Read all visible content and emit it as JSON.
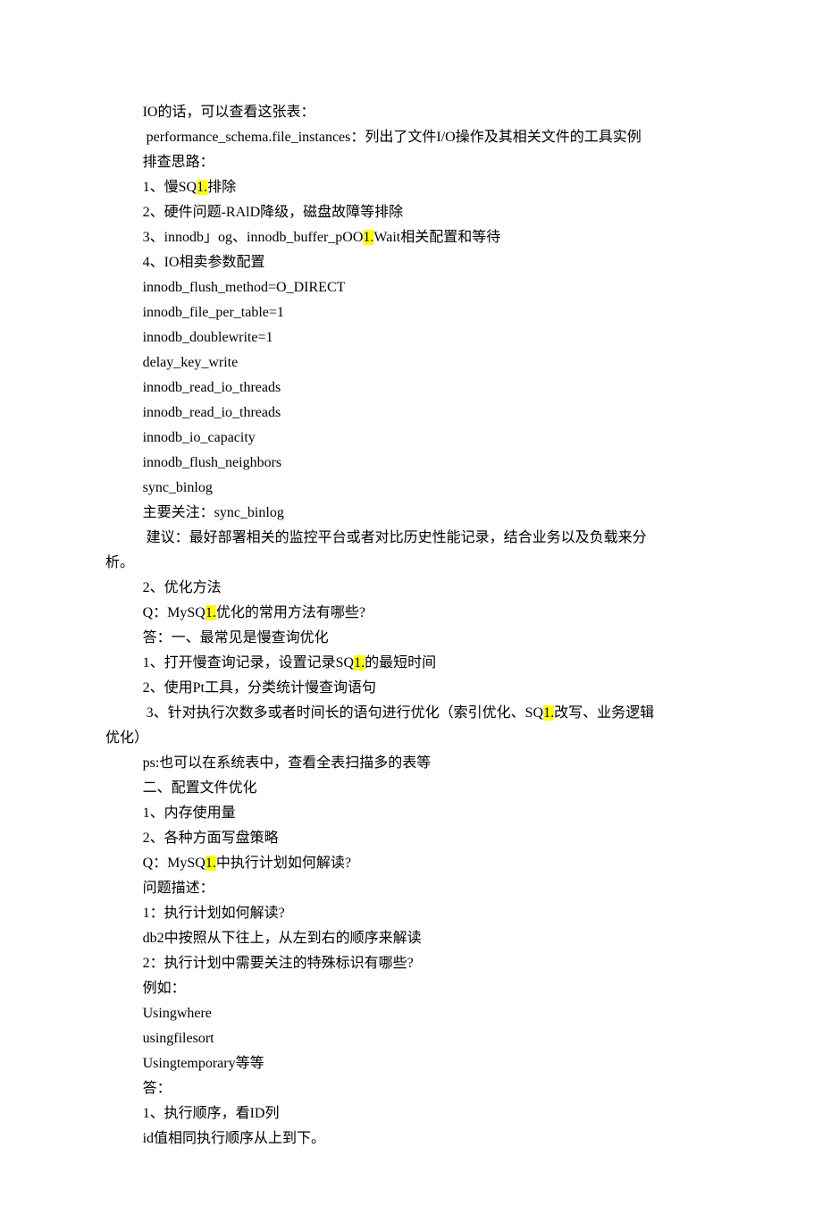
{
  "lines": [
    {
      "indent": true,
      "segments": [
        {
          "t": "IO的话，可以查看这张表："
        }
      ]
    },
    {
      "indent": true,
      "segments": [
        {
          "t": " performance_schema.file_instances：列出了文件I/O操作及其相关文件的工具实例"
        }
      ]
    },
    {
      "indent": true,
      "segments": [
        {
          "t": "排查思路："
        }
      ]
    },
    {
      "indent": true,
      "segments": [
        {
          "t": "1、慢SQ"
        },
        {
          "t": "1.",
          "hl": true
        },
        {
          "t": "排除"
        }
      ]
    },
    {
      "indent": true,
      "segments": [
        {
          "t": "2、硬件问题-RAlD降级，磁盘故障等排除"
        }
      ]
    },
    {
      "indent": true,
      "segments": [
        {
          "t": "3、innodb」og、innodb_buffer_pOO"
        },
        {
          "t": "1.",
          "hl": true
        },
        {
          "t": "Wait相关配置和等待"
        }
      ]
    },
    {
      "indent": true,
      "segments": [
        {
          "t": "4、IO相卖参数配置"
        }
      ]
    },
    {
      "indent": true,
      "segments": [
        {
          "t": "innodb_flush_method=O_DIRECT"
        }
      ]
    },
    {
      "indent": true,
      "segments": [
        {
          "t": "innodb_file_per_table=1"
        }
      ]
    },
    {
      "indent": true,
      "segments": [
        {
          "t": "innodb_doublewrite=1"
        }
      ]
    },
    {
      "indent": true,
      "segments": [
        {
          "t": "delay_key_write"
        }
      ]
    },
    {
      "indent": true,
      "segments": [
        {
          "t": "innodb_read_io_threads"
        }
      ]
    },
    {
      "indent": true,
      "segments": [
        {
          "t": "innodb_read_io_threads"
        }
      ]
    },
    {
      "indent": true,
      "segments": [
        {
          "t": "innodb_io_capacity"
        }
      ]
    },
    {
      "indent": true,
      "segments": [
        {
          "t": "innodb_flush_neighbors"
        }
      ]
    },
    {
      "indent": true,
      "segments": [
        {
          "t": "sync_binlog"
        }
      ]
    },
    {
      "indent": true,
      "segments": [
        {
          "t": "主要关注：sync_binlog"
        }
      ]
    },
    {
      "indent": true,
      "segments": [
        {
          "t": " 建议：最好部署相关的监控平台或者对比历史性能记录，结合业务以及负载来分"
        }
      ]
    },
    {
      "indent": false,
      "segments": [
        {
          "t": "析。"
        }
      ]
    },
    {
      "indent": true,
      "segments": [
        {
          "t": "2、优化方法"
        }
      ]
    },
    {
      "indent": true,
      "segments": [
        {
          "t": "Q：MySQ"
        },
        {
          "t": "1.",
          "hl": true
        },
        {
          "t": "优化的常用方法有哪些?"
        }
      ]
    },
    {
      "indent": true,
      "segments": [
        {
          "t": "答：一、最常见是慢查询优化"
        }
      ]
    },
    {
      "indent": true,
      "segments": [
        {
          "t": "1、打开慢查询记录，设置记录SQ"
        },
        {
          "t": "1.",
          "hl": true
        },
        {
          "t": "的最短时间"
        }
      ]
    },
    {
      "indent": true,
      "segments": [
        {
          "t": "2、使用Pt工具，分类统计慢查询语句"
        }
      ]
    },
    {
      "indent": true,
      "segments": [
        {
          "t": " 3、针对执行次数多或者时间长的语句进行优化（索引优化、SQ"
        },
        {
          "t": "1.",
          "hl": true
        },
        {
          "t": "改写、业务逻辑"
        }
      ]
    },
    {
      "indent": false,
      "segments": [
        {
          "t": "优化）"
        }
      ]
    },
    {
      "indent": true,
      "segments": [
        {
          "t": "ps:也可以在系统表中，查看全表扫描多的表等"
        }
      ]
    },
    {
      "indent": true,
      "segments": [
        {
          "t": "二、配置文件优化"
        }
      ]
    },
    {
      "indent": true,
      "segments": [
        {
          "t": "1、内存使用量"
        }
      ]
    },
    {
      "indent": true,
      "segments": [
        {
          "t": "2、各种方面写盘策略"
        }
      ]
    },
    {
      "indent": true,
      "segments": [
        {
          "t": "Q：MySQ"
        },
        {
          "t": "1.",
          "hl": true
        },
        {
          "t": "中执行计划如何解读?"
        }
      ]
    },
    {
      "indent": true,
      "segments": [
        {
          "t": "问题描述："
        }
      ]
    },
    {
      "indent": true,
      "segments": [
        {
          "t": "1：执行计划如何解读?"
        }
      ]
    },
    {
      "indent": true,
      "segments": [
        {
          "t": "db2中按照从下往上，从左到右的顺序来解读"
        }
      ]
    },
    {
      "indent": true,
      "segments": [
        {
          "t": "2：执行计划中需要关注的特殊标识有哪些?"
        }
      ]
    },
    {
      "indent": true,
      "segments": [
        {
          "t": "例如："
        }
      ]
    },
    {
      "indent": true,
      "segments": [
        {
          "t": "Usingwhere"
        }
      ]
    },
    {
      "indent": true,
      "segments": [
        {
          "t": "usingfilesort"
        }
      ]
    },
    {
      "indent": true,
      "segments": [
        {
          "t": "Usingtemporary等等"
        }
      ]
    },
    {
      "indent": true,
      "segments": [
        {
          "t": "答："
        }
      ]
    },
    {
      "indent": true,
      "segments": [
        {
          "t": "1、执行顺序，看ID列"
        }
      ]
    },
    {
      "indent": true,
      "segments": [
        {
          "t": "id值相同执行顺序从上到下。"
        }
      ]
    }
  ]
}
